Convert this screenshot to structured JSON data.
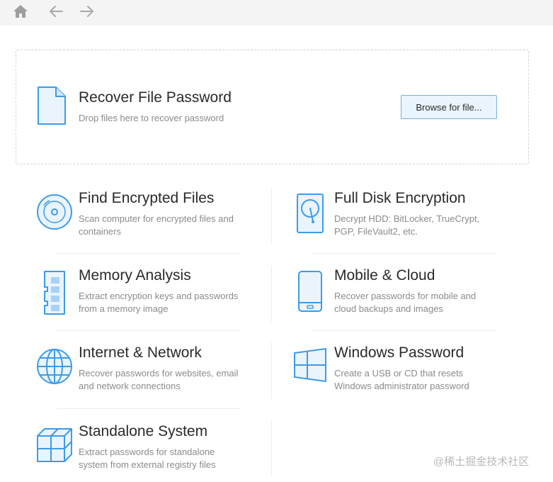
{
  "toolbar": {
    "home_icon": "home-icon",
    "back_icon": "arrow-left-icon",
    "forward_icon": "arrow-right-icon"
  },
  "dropzone": {
    "icon": "file-icon",
    "title": "Recover File Password",
    "subtitle": "Drop files here to recover password",
    "button_label": "Browse for file..."
  },
  "cards": [
    {
      "icon": "disc-icon",
      "title": "Find Encrypted Files",
      "desc": "Scan computer for encrypted files and containers"
    },
    {
      "icon": "hard-drive-icon",
      "title": "Full Disk Encryption",
      "desc": "Decrypt HDD: BitLocker, TrueCrypt, PGP, FileVault2, etc."
    },
    {
      "icon": "memory-chip-icon",
      "title": "Memory Analysis",
      "desc": "Extract encryption keys and passwords from a memory image"
    },
    {
      "icon": "mobile-phone-icon",
      "title": "Mobile & Cloud",
      "desc": "Recover passwords for mobile and cloud backups and images"
    },
    {
      "icon": "globe-icon",
      "title": "Internet & Network",
      "desc": "Recover passwords for websites, email and network connections"
    },
    {
      "icon": "windows-logo-icon",
      "title": "Windows Password",
      "desc": "Create a USB or CD that resets Windows administrator password"
    },
    {
      "icon": "cubes-icon",
      "title": "Standalone System",
      "desc": "Extract passwords for standalone system from external registry files"
    }
  ],
  "watermark": "@稀土掘金技术社区",
  "colors": {
    "accent": "#3d9be9",
    "toolbar_bg": "#f4f4f4",
    "toolbar_icon": "#9e9e9e",
    "title_text": "#2a2a2a",
    "desc_text": "#8b8b8b",
    "button_bg": "#eaf4fc",
    "button_border": "#6fb3e8"
  }
}
